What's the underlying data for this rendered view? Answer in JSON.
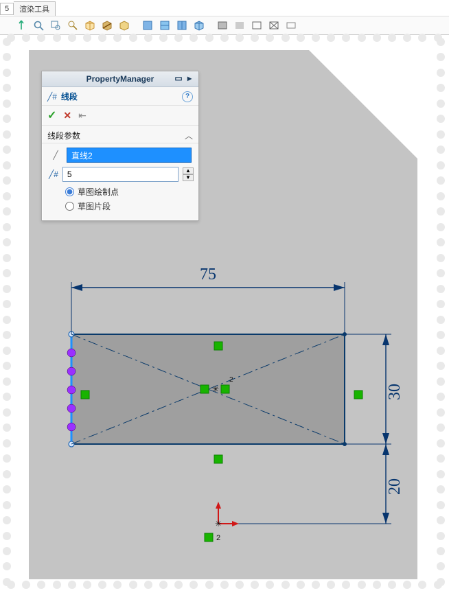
{
  "top_tab": {
    "index": "5",
    "label": "渲染工具"
  },
  "toolbar": {
    "icons": [
      "axis-arrow-icon",
      "zoom-fit-icon",
      "zoom-area-icon",
      "zoom-select-icon",
      "trimetric-icon",
      "section-icon",
      "render-icon",
      "view-front-icon",
      "view-top-icon",
      "view-right-icon",
      "view-iso-icon",
      "shaded-edges-icon",
      "shaded-icon",
      "hidden-removed-icon",
      "wireframe-icon",
      "more-views-icon"
    ]
  },
  "property_manager": {
    "title": "PropertyManager",
    "feature_label": "线段",
    "help_tooltip": "?",
    "actions": {
      "ok": "✓",
      "cancel": "✕",
      "pin": "📌"
    },
    "section_title": "线段参数",
    "entity_value": "直线2",
    "count_value": "5",
    "radio_options": {
      "sketch_points": "草图绘制点",
      "sketch_segments": "草图片段"
    },
    "radio_selected": "sketch_points"
  },
  "dimensions": {
    "width_label": "75",
    "height_label": "30",
    "offset_label": "20"
  },
  "origin_marker_label": "2",
  "center_marker_label": "2"
}
